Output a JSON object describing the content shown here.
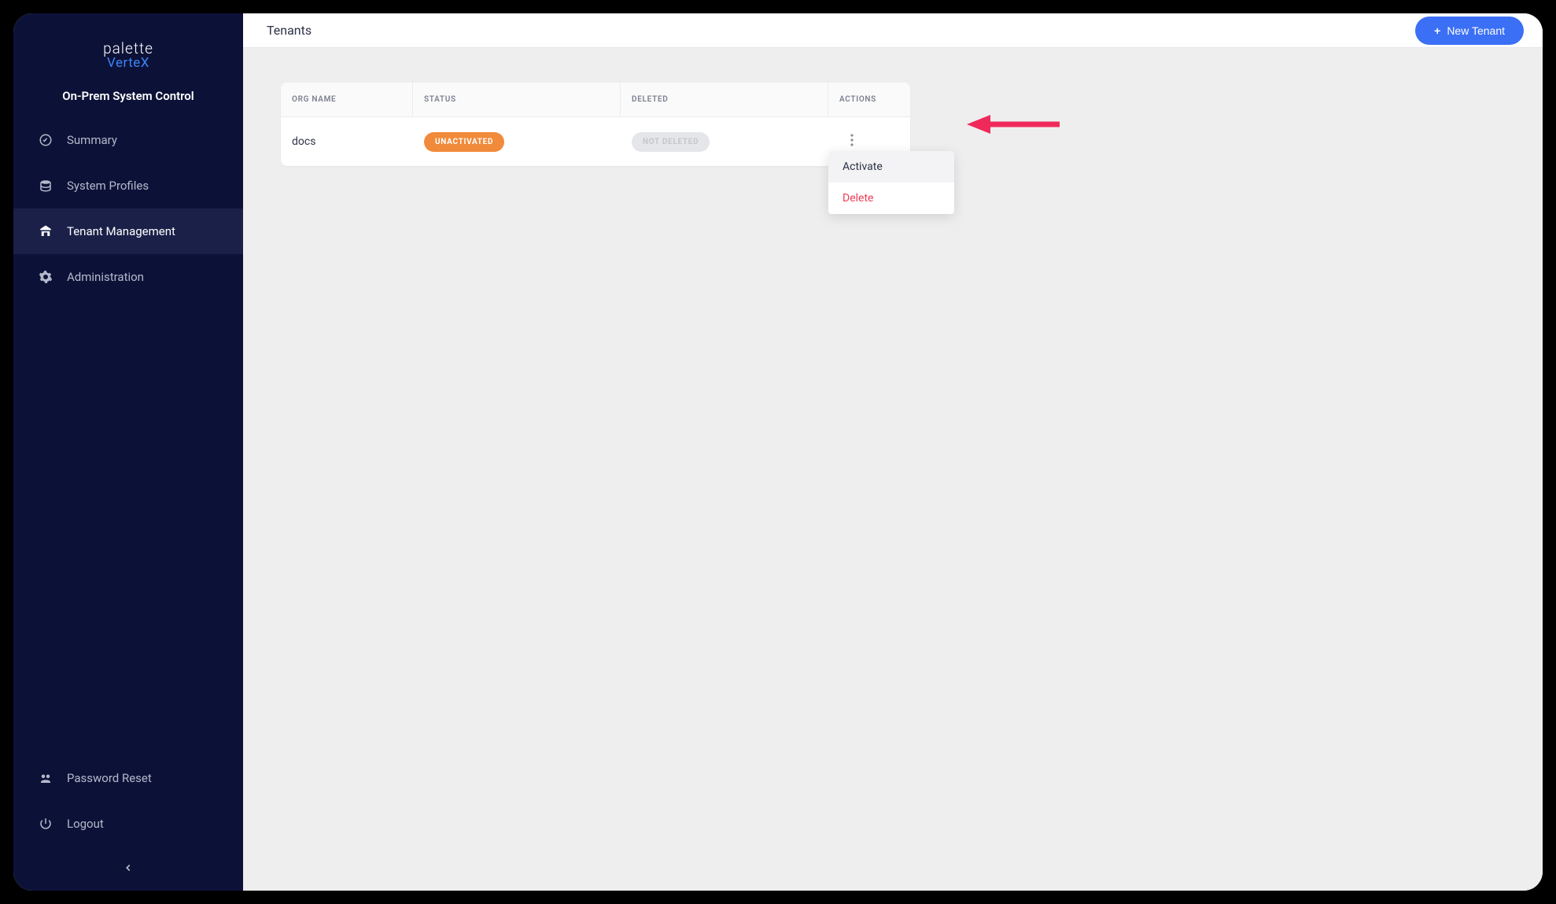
{
  "brand": {
    "line1": "palette",
    "line2": "VerteX",
    "subtitle": "On-Prem System Control"
  },
  "sidebar": {
    "items": [
      {
        "label": "Summary",
        "icon": "chart"
      },
      {
        "label": "System Profiles",
        "icon": "stack"
      },
      {
        "label": "Tenant Management",
        "icon": "tenant"
      },
      {
        "label": "Administration",
        "icon": "gear"
      }
    ],
    "bottom": [
      {
        "label": "Password Reset",
        "icon": "key"
      },
      {
        "label": "Logout",
        "icon": "power"
      }
    ]
  },
  "header": {
    "title": "Tenants",
    "new_tenant_label": "New Tenant"
  },
  "table": {
    "columns": {
      "org": "ORG NAME",
      "status": "STATUS",
      "deleted": "DELETED",
      "actions": "ACTIONS"
    },
    "rows": [
      {
        "org": "docs",
        "status": "UNACTIVATED",
        "deleted": "NOT DELETED"
      }
    ]
  },
  "dropdown": {
    "activate": "Activate",
    "delete": "Delete"
  }
}
